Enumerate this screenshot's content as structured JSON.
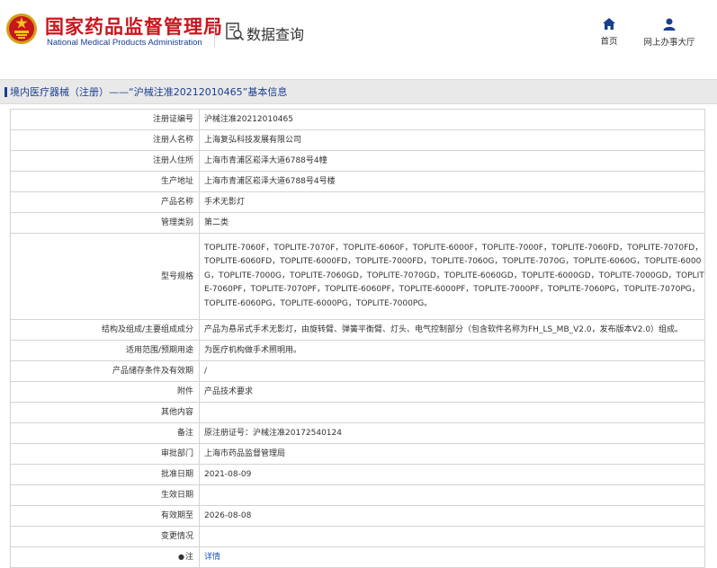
{
  "header": {
    "site_name_cn": "国家药品监督管理局",
    "site_name_en": "National Medical Products Administration",
    "query_title": "数据查询",
    "nav": {
      "home": "首页",
      "office": "网上办事大厅"
    }
  },
  "breadcrumb": "境内医疗器械（注册）——“沪械注准20212010465”基本信息",
  "rows": [
    {
      "label": "注册证编号",
      "value": "沪械注准20212010465"
    },
    {
      "label": "注册人名称",
      "value": "上海复弘科技发展有限公司"
    },
    {
      "label": "注册人住所",
      "value": "上海市青浦区崧泽大道6788号4幢"
    },
    {
      "label": "生产地址",
      "value": "上海市青浦区崧泽大道6788号4号楼"
    },
    {
      "label": "产品名称",
      "value": "手术无影灯"
    },
    {
      "label": "管理类别",
      "value": "第二类"
    },
    {
      "label": "型号规格",
      "value": "TOPLITE-7060F，TOPLITE-7070F，TOPLITE-6060F，TOPLITE-6000F，TOPLITE-7000F，TOPLITE-7060FD，TOPLITE-7070FD，TOPLITE-6060FD，TOPLITE-6000FD，TOPLITE-7000FD，TOPLITE-7060G，TOPLITE-7070G，TOPLITE-6060G，TOPLITE-6000G，TOPLITE-7000G，TOPLITE-7060GD，TOPLITE-7070GD，TOPLITE-6060GD，TOPLITE-6000GD，TOPLITE-7000GD，TOPLITE-7060PF，TOPLITE-7070PF，TOPLITE-6060PF，TOPLITE-6000PF，TOPLITE-7000PF，TOPLITE-7060PG，TOPLITE-7070PG，TOPLITE-6060PG，TOPLITE-6000PG，TOPLITE-7000PG。"
    },
    {
      "label": "结构及组成/主要组成成分",
      "value": "产品为悬吊式手术无影灯，由旋转臂、弹簧平衡臂、灯头、电气控制部分（包含软件名称为FH_LS_MB_V2.0，发布版本V2.0）组成。"
    },
    {
      "label": "适用范围/预期用途",
      "value": "为医疗机构做手术照明用。"
    },
    {
      "label": "产品储存条件及有效期",
      "value": "/"
    },
    {
      "label": "附件",
      "value": "产品技术要求"
    },
    {
      "label": "其他内容",
      "value": ""
    },
    {
      "label": "备注",
      "value": "原注册证号：沪械注准20172540124"
    },
    {
      "label": "审批部门",
      "value": "上海市药品监督管理局"
    },
    {
      "label": "批准日期",
      "value": "2021-08-09"
    },
    {
      "label": "生效日期",
      "value": ""
    },
    {
      "label": "有效期至",
      "value": "2026-08-08"
    },
    {
      "label": "变更情况",
      "value": ""
    },
    {
      "label": "注",
      "value": "详情"
    }
  ],
  "colors": {
    "brand_red": "#c8161d",
    "brand_blue": "#1b3f8f",
    "link_blue": "#1a56b8"
  }
}
